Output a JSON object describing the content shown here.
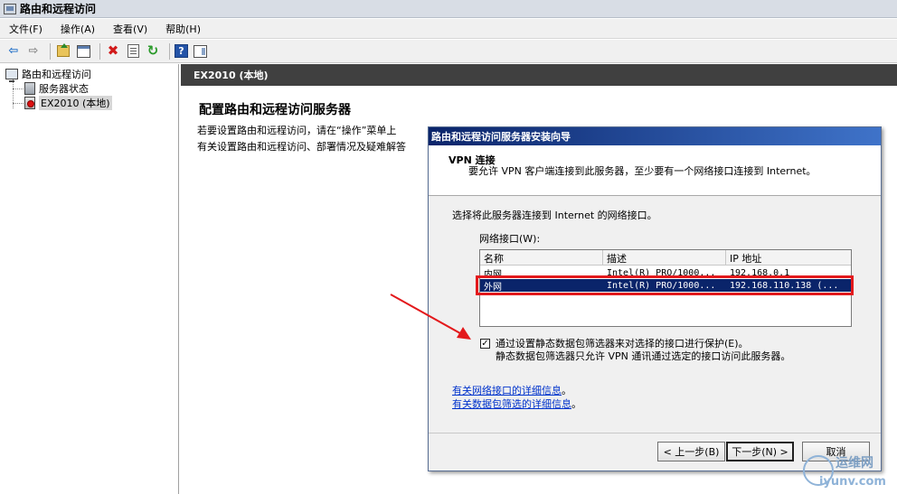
{
  "window": {
    "title": "路由和远程访问"
  },
  "menu": [
    "文件(F)",
    "操作(A)",
    "查看(V)",
    "帮助(H)"
  ],
  "toolbar": [
    "back-icon",
    "forward-icon",
    "up-folder-icon",
    "show-tree-icon",
    "delete-icon",
    "properties-icon",
    "refresh-icon",
    "help-icon",
    "show-action-pane-icon"
  ],
  "tree": {
    "root": "路由和远程访问",
    "items": [
      "服务器状态",
      "EX2010 (本地)"
    ]
  },
  "content": {
    "header": "EX2010 (本地)",
    "heading": "配置路由和远程访问服务器",
    "lines": [
      "若要设置路由和远程访问，请在“操作”菜单上",
      "有关设置路由和远程访问、部署情况及疑难解答"
    ]
  },
  "wizard": {
    "title": "路由和远程访问服务器安装向导",
    "head_title": "VPN 连接",
    "head_desc": "要允许 VPN 客户端连接到此服务器，至少要有一个网络接口连接到 Internet。",
    "prompt": "选择将此服务器连接到 Internet 的网络接口。",
    "list_label": "网络接口(W):",
    "columns": [
      "名称",
      "描述",
      "IP 地址"
    ],
    "rows": [
      {
        "name": "内网",
        "desc": "Intel(R) PRO/1000...",
        "ip": "192.168.0.1"
      },
      {
        "name": "外网",
        "desc": "Intel(R) PRO/1000...",
        "ip": "192.168.110.138 (..."
      }
    ],
    "checkbox_label": "通过设置静态数据包筛选器来对选择的接口进行保护(E)。",
    "checkbox_desc": "静态数据包筛选器只允许 VPN 通讯通过选定的接口访问此服务器。",
    "link1": "有关网络接口的详细信息",
    "link1_suffix": "。",
    "link2": "有关数据包筛选的详细信息",
    "link2_suffix": "。",
    "back_label": "< 上一步(B)",
    "next_label": "下一步(N) >",
    "cancel_label": "取消"
  },
  "watermark": {
    "top": "运维网",
    "bottom": "iyunv.com"
  },
  "colors": {
    "selection": "#0a246a",
    "highlight_box": "#e3191c",
    "content_header": "#404040"
  }
}
